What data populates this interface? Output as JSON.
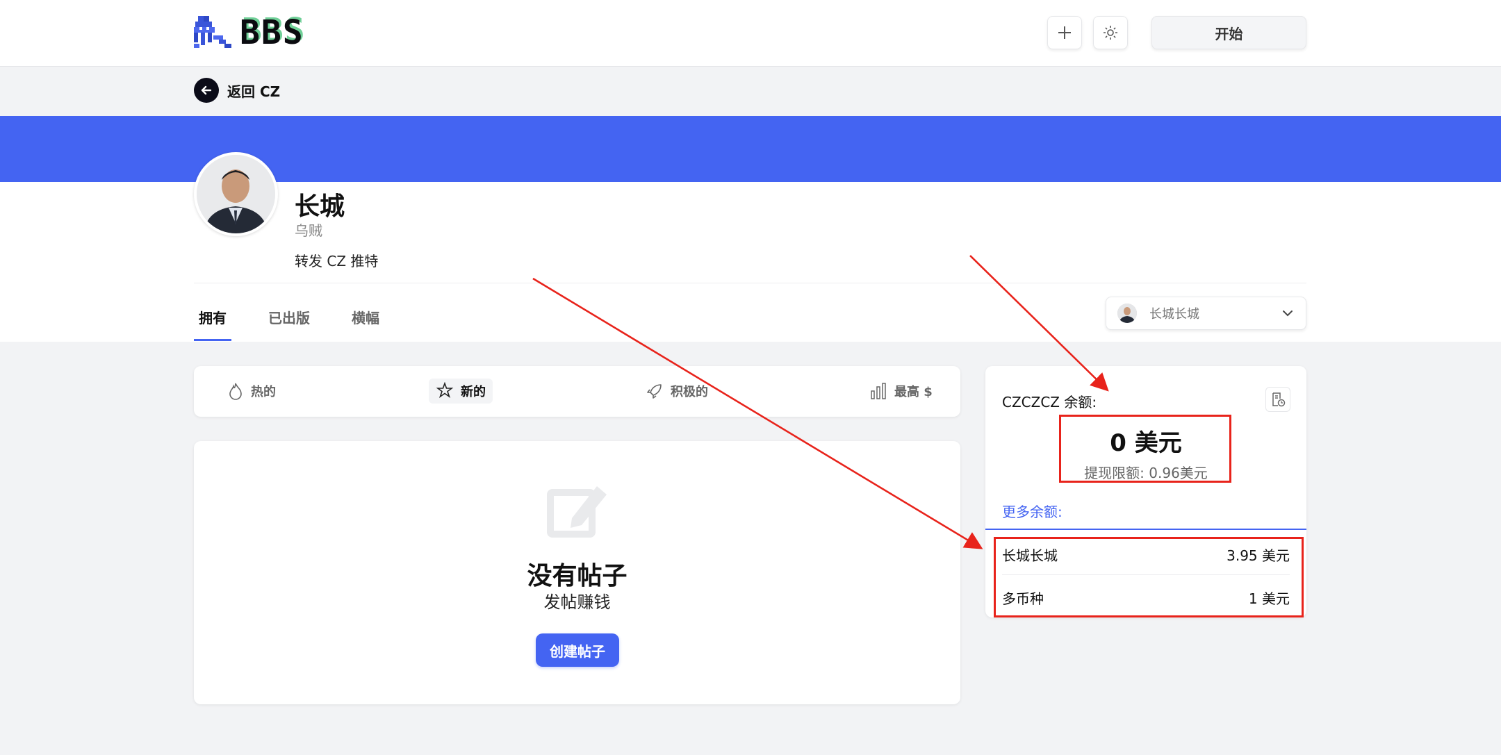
{
  "header": {
    "logo_text": "BBS",
    "plus_icon": "plus-icon",
    "theme_icon": "sun-icon",
    "start_label": "开始"
  },
  "back": {
    "label": "返回 CZ"
  },
  "profile": {
    "name": "长城",
    "handle": "乌贼",
    "bio": "转发 CZ 推特"
  },
  "tabs": [
    {
      "label": "拥有",
      "active": true
    },
    {
      "label": "已出版",
      "active": false
    },
    {
      "label": "横幅",
      "active": false
    }
  ],
  "user_select": {
    "label": "长城长城"
  },
  "sort": [
    {
      "label": "热的",
      "icon": "flame-icon",
      "active": false
    },
    {
      "label": "新的",
      "icon": "star-icon",
      "active": true
    },
    {
      "label": "积极的",
      "icon": "rocket-icon",
      "active": false
    },
    {
      "label": "最高 $",
      "icon": "bar-chart-icon",
      "active": false
    }
  ],
  "empty": {
    "title": "没有帖子",
    "subtitle": "发帖赚钱",
    "button": "创建帖子"
  },
  "balance": {
    "label": "CZCZCZ 余额:",
    "amount": "0 美元",
    "limit": "提现限额:  0.96美元",
    "more_label": "更多余额:",
    "rows": [
      {
        "name": "长城长城",
        "value": "3.95 美元"
      },
      {
        "name": "多币种",
        "value": "1 美元"
      }
    ]
  },
  "colors": {
    "accent": "#4464f2",
    "annotation": "#e8231b"
  }
}
